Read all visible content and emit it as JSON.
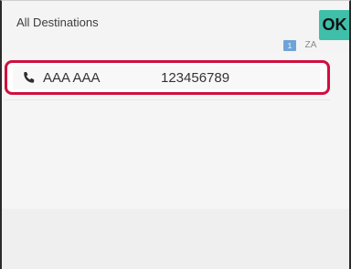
{
  "header": {
    "title": "All Destinations",
    "ok_label": "OK"
  },
  "pagination": {
    "current_page": "1"
  },
  "sort": {
    "icon_text": "ZA"
  },
  "destinations": [
    {
      "name": "AAA AAA",
      "number": "123456789",
      "type_icon": "phone-icon"
    }
  ],
  "colors": {
    "ok_button": "#3fbfa9",
    "selection_border": "#d0103f",
    "page_indicator": "#6fa4d8"
  }
}
